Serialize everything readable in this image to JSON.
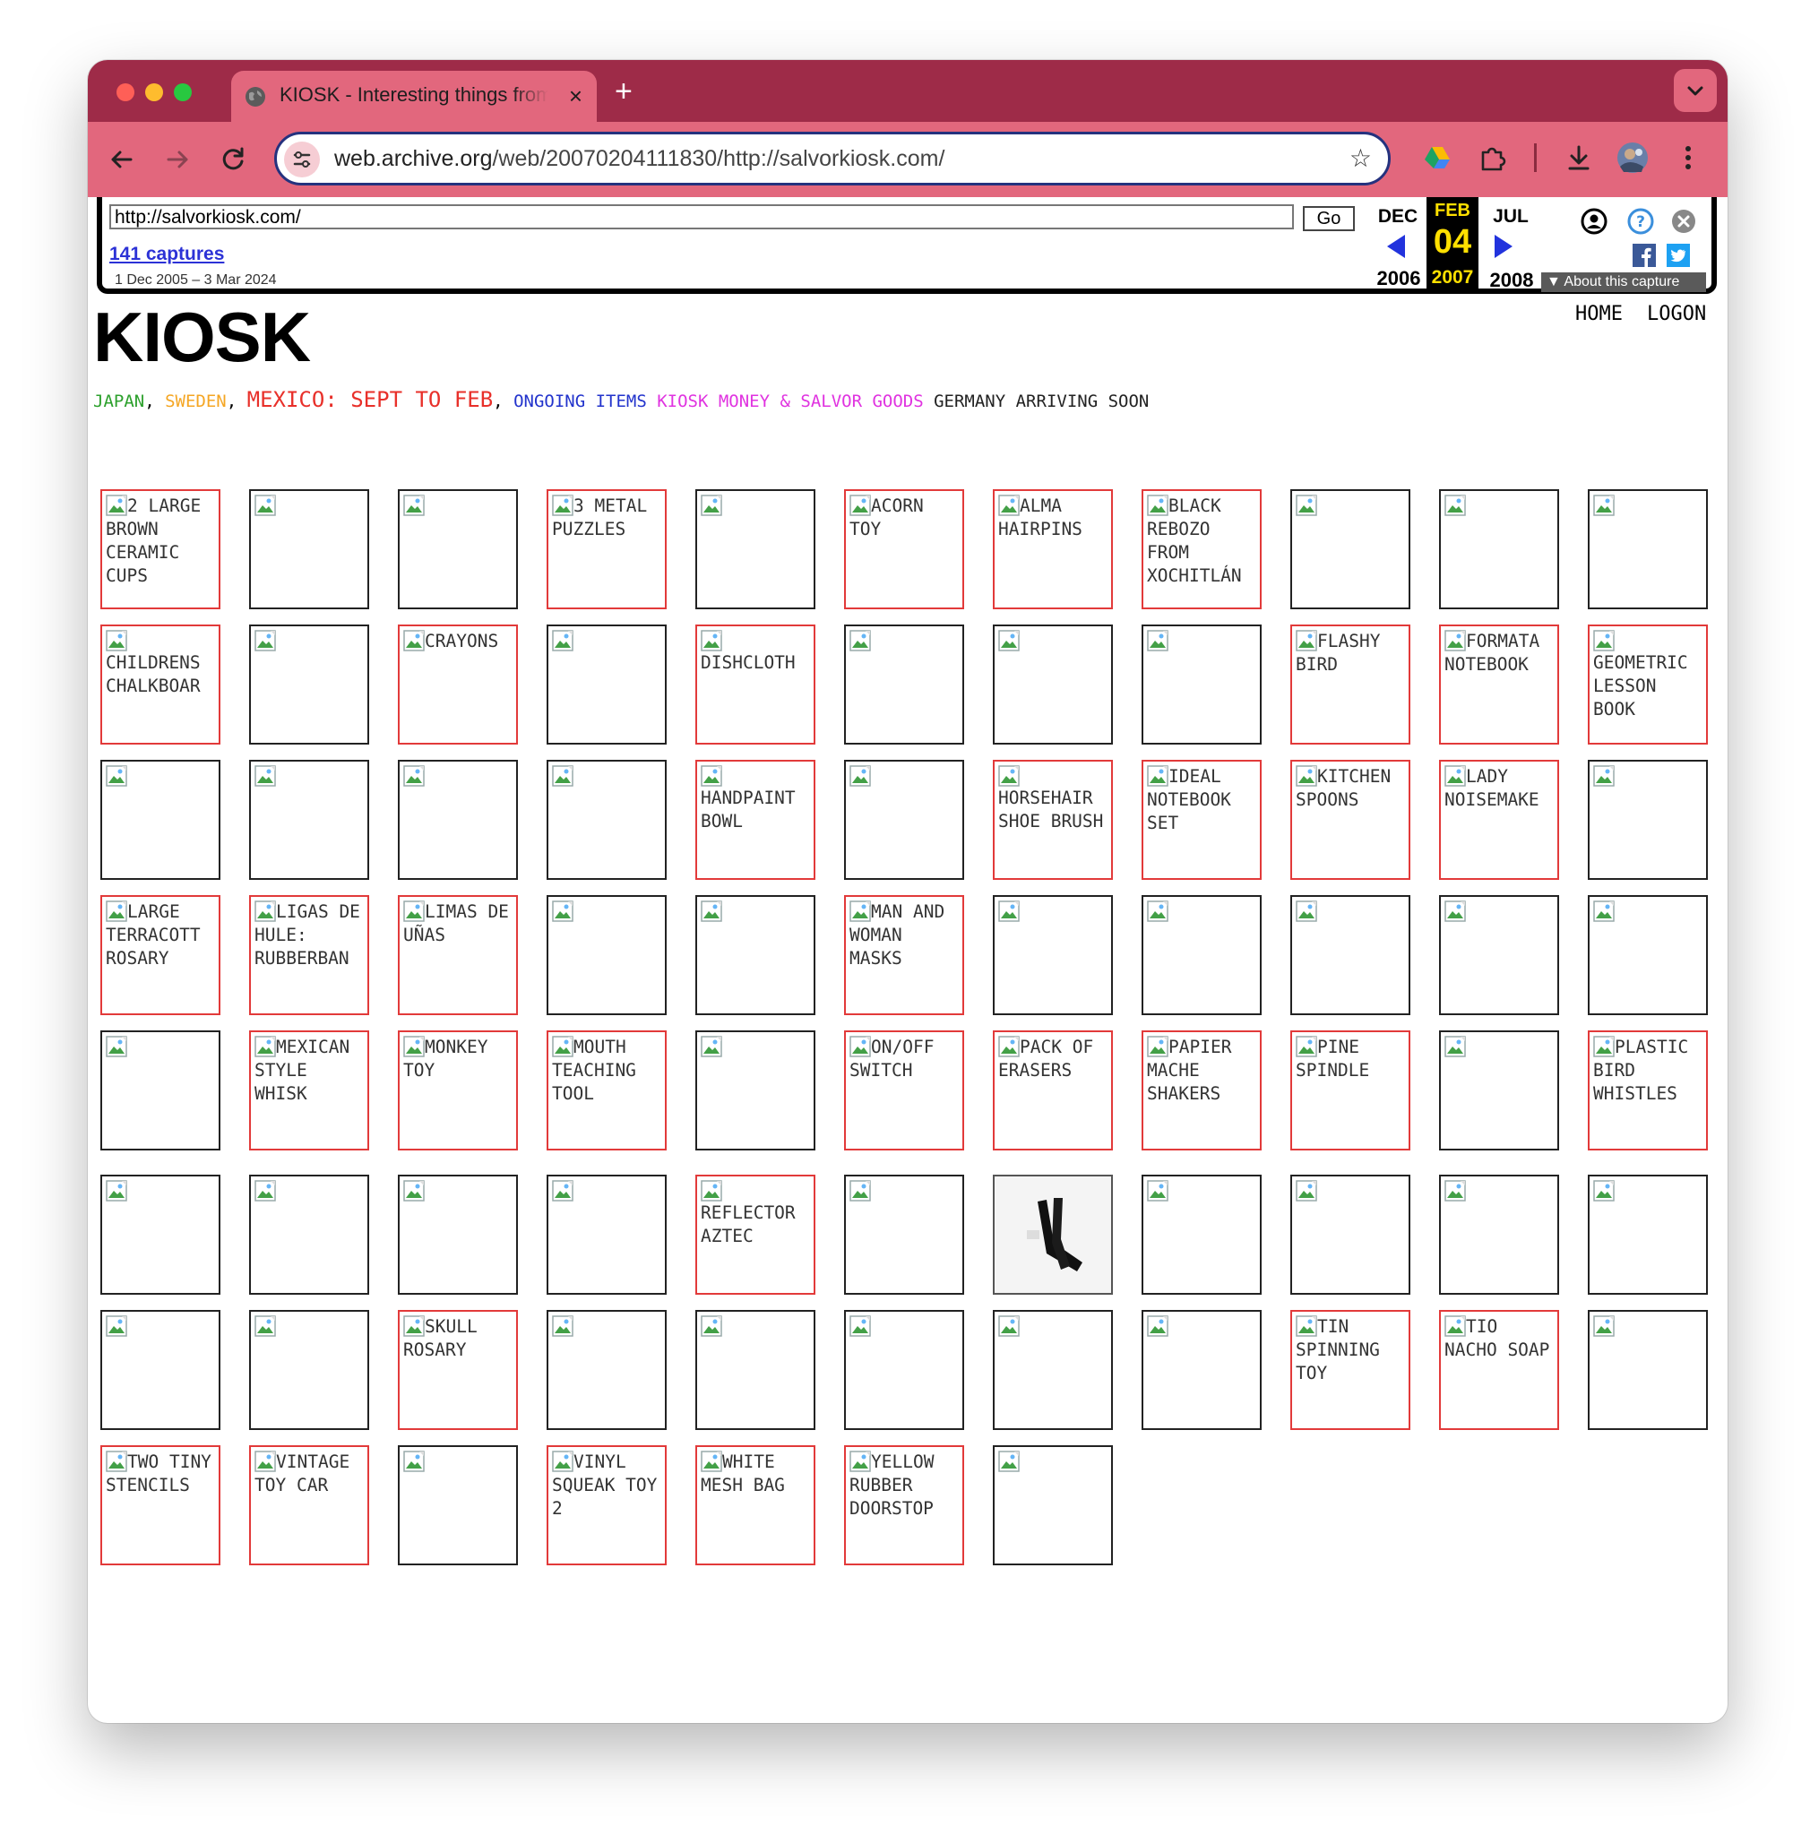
{
  "browser": {
    "tab_title": "KIOSK - Interesting things from",
    "tab_close": "×",
    "new_tab": "+",
    "url_host": "web.archive.org",
    "url_path": "/web/20070204111830/http://salvorkiosk.com/",
    "star": "☆",
    "colors": {
      "tabstrip": "#9e2b48",
      "toolbar": "#e2677d",
      "omnibox_border": "#25327e"
    }
  },
  "wayback": {
    "url_value": "http://salvorkiosk.com/",
    "go_label": "Go",
    "captures_label": "141 captures",
    "date_range": "1 Dec 2005 – 3 Mar 2024",
    "prev_month": "DEC",
    "prev_year": "2006",
    "cur_month": "FEB",
    "cur_day": "04",
    "cur_year": "2007",
    "next_month": "JUL",
    "next_year": "2008",
    "about_label": "▼ About this capture"
  },
  "site": {
    "title": "KIOSK",
    "home": "HOME",
    "logon": "LOGON",
    "categories": [
      {
        "text": "JAPAN",
        "color": "#2ca02c"
      },
      {
        "text": ", ",
        "color": "#000000"
      },
      {
        "text": "SWEDEN",
        "color": "#f5a623"
      },
      {
        "text": ", ",
        "color": "#000000"
      },
      {
        "text": "MEXICO: SEPT TO FEB",
        "color": "#e8302a"
      },
      {
        "text": ", ",
        "color": "#000000"
      },
      {
        "text": "ONGOING ITEMS",
        "color": "#2233cc"
      },
      {
        "text": " ",
        "color": "#000000"
      },
      {
        "text": "KIOSK MONEY & SALVOR GOODS",
        "color": "#e033e0"
      },
      {
        "text": " ",
        "color": "#000000"
      },
      {
        "text": "GERMANY ARRIVING SOON",
        "color": "#222222"
      }
    ]
  },
  "grid": [
    [
      "2 LARGE BROWN CERAMIC CUPS",
      "",
      "",
      "3 METAL PUZZLES",
      "",
      "ACORN TOY",
      "ALMA HAIRPINS",
      "BLACK REBOZO FROM XOCHITLÁN",
      "",
      "",
      ""
    ],
    [
      "CHILDRENS CHALKBOAR",
      "",
      "CRAYONS",
      "",
      "DISHCLOTH",
      "",
      "",
      "",
      "FLASHY BIRD",
      "FORMATA NOTEBOOK",
      "GEOMETRIC LESSON BOOK"
    ],
    [
      "",
      "",
      "",
      "",
      "HANDPAINT BOWL",
      "",
      "HORSEHAIR SHOE BRUSH",
      "IDEAL NOTEBOOK SET",
      "KITCHEN SPOONS",
      "LADY NOISEMAKE",
      ""
    ],
    [
      "LARGE TERRACOTT ROSARY",
      "LIGAS DE HULE: RUBBERBAN",
      "LIMAS DE UÑAS",
      "",
      "",
      "MAN AND WOMAN MASKS",
      "",
      "",
      "",
      "",
      ""
    ],
    [
      "",
      "MEXICAN STYLE WHISK",
      "MONKEY TOY",
      "MOUTH TEACHING TOOL",
      "",
      "ON/OFF SWITCH",
      "PACK OF ERASERS",
      "PAPIER MACHE SHAKERS",
      "PINE SPINDLE",
      "",
      "PLASTIC BIRD WHISTLES"
    ],
    [
      "",
      "",
      "",
      "",
      "REFLECTOR AZTEC",
      "",
      "[photo]",
      "",
      "",
      "",
      ""
    ],
    [
      "",
      "",
      "SKULL ROSARY",
      "",
      "",
      "",
      "",
      "",
      "TIN SPINNING TOY",
      "TIO NACHO SOAP",
      ""
    ],
    [
      "TWO TINY STENCILS",
      "VINTAGE TOY CAR",
      "",
      "VINYL SQUEAK TOY 2",
      "WHITE MESH BAG",
      "YELLOW RUBBER DOORSTOP",
      ""
    ]
  ]
}
